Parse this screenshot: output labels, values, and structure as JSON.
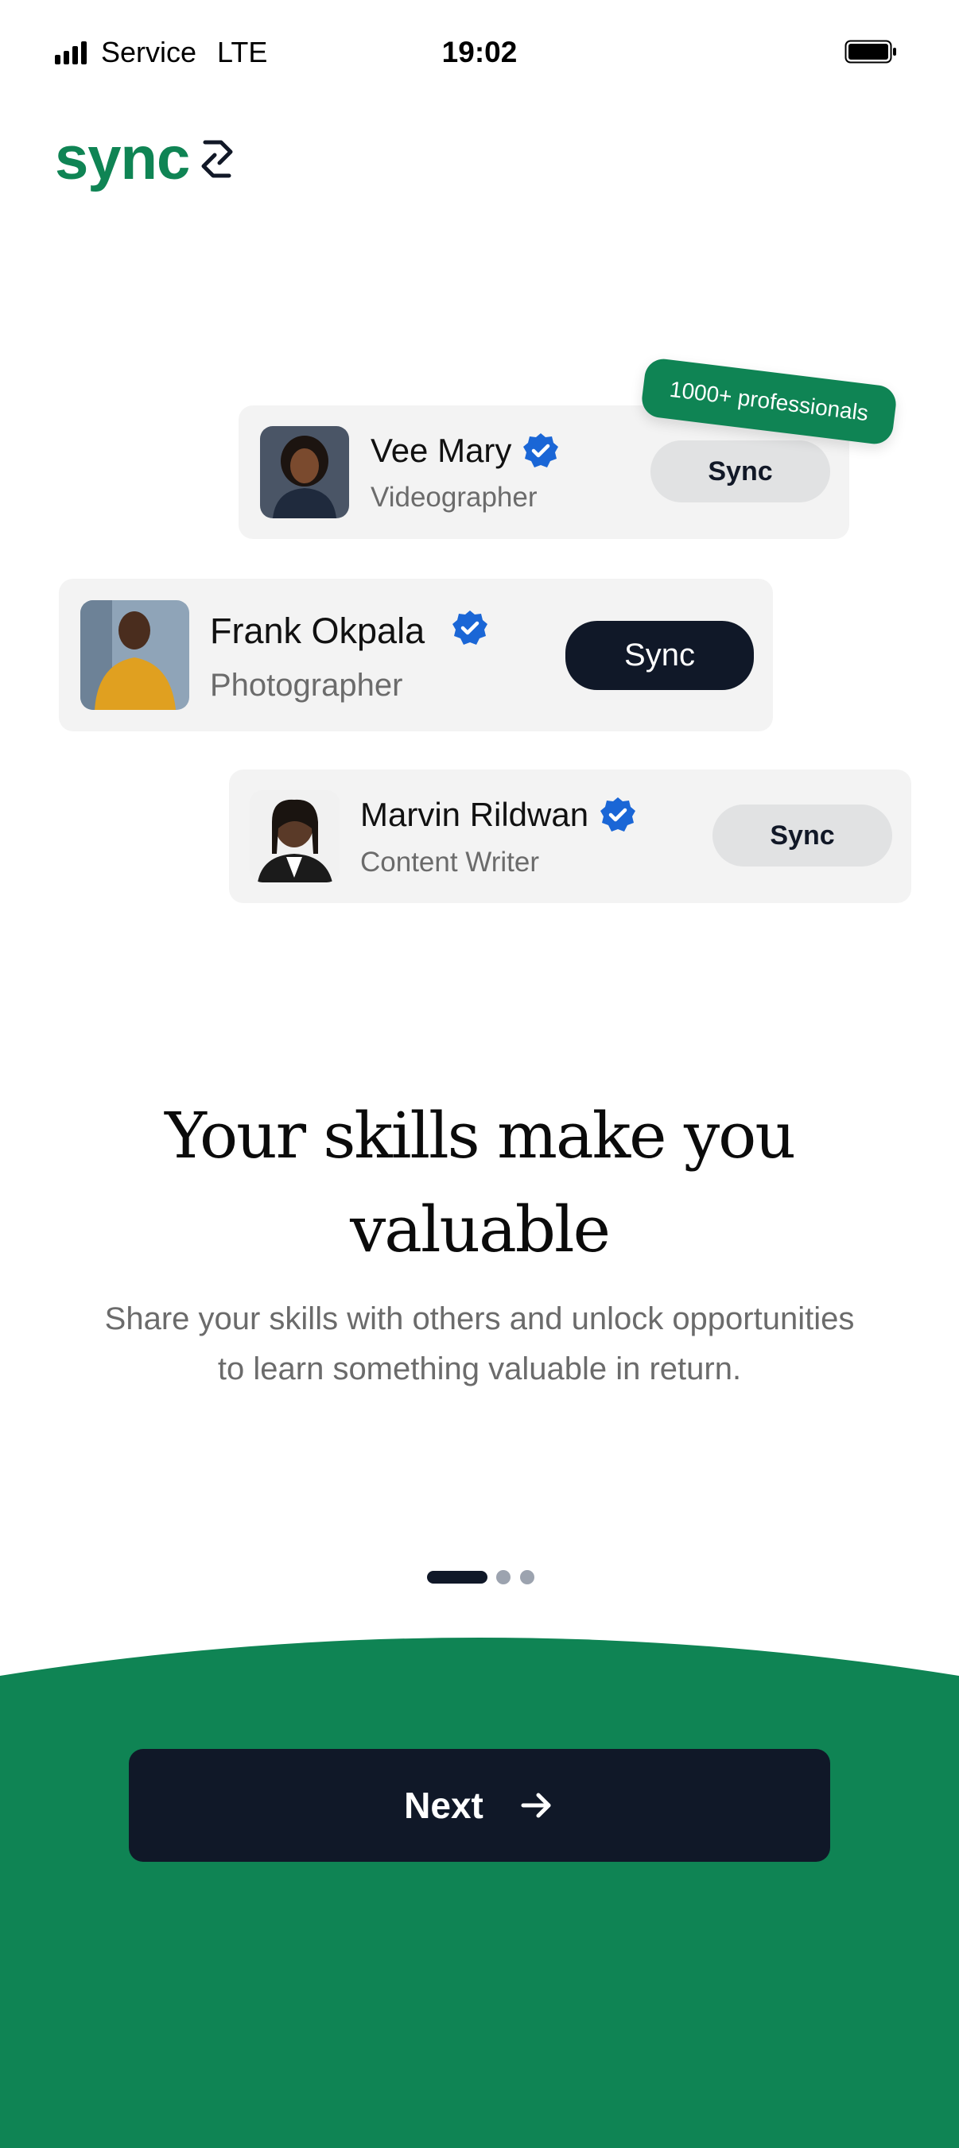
{
  "status_bar": {
    "carrier": "Service",
    "network": "LTE",
    "time": "19:02",
    "icons": [
      "signal-icon",
      "battery-icon"
    ]
  },
  "brand": {
    "logo_text": "sync",
    "logo_icon": "sync-logo-icon",
    "color": "#0f8454"
  },
  "badge": {
    "label": "1000+ professionals"
  },
  "profiles": [
    {
      "name": "Vee Mary",
      "role": "Videographer",
      "button_label": "Sync",
      "verified": true,
      "button_style": "light"
    },
    {
      "name": "Frank Okpala",
      "role": "Photographer",
      "button_label": "Sync",
      "verified": true,
      "button_style": "dark"
    },
    {
      "name": "Marvin Rildwan",
      "role": "Content Writer",
      "button_label": "Sync",
      "verified": true,
      "button_style": "light"
    }
  ],
  "onboarding": {
    "headline_line1": "Your skills make you",
    "headline_line2": "valuable",
    "description_line1": "Share your skills with others and unlock opportunities",
    "description_line2": "to learn something valuable in return.",
    "current_page": 1,
    "total_pages": 3
  },
  "footer": {
    "next_label": "Next",
    "next_icon": "arrow-right-icon"
  },
  "colors": {
    "accent": "#0f8454",
    "dark": "#101828",
    "verified": "#1a66d6",
    "card": "#f3f3f3"
  }
}
